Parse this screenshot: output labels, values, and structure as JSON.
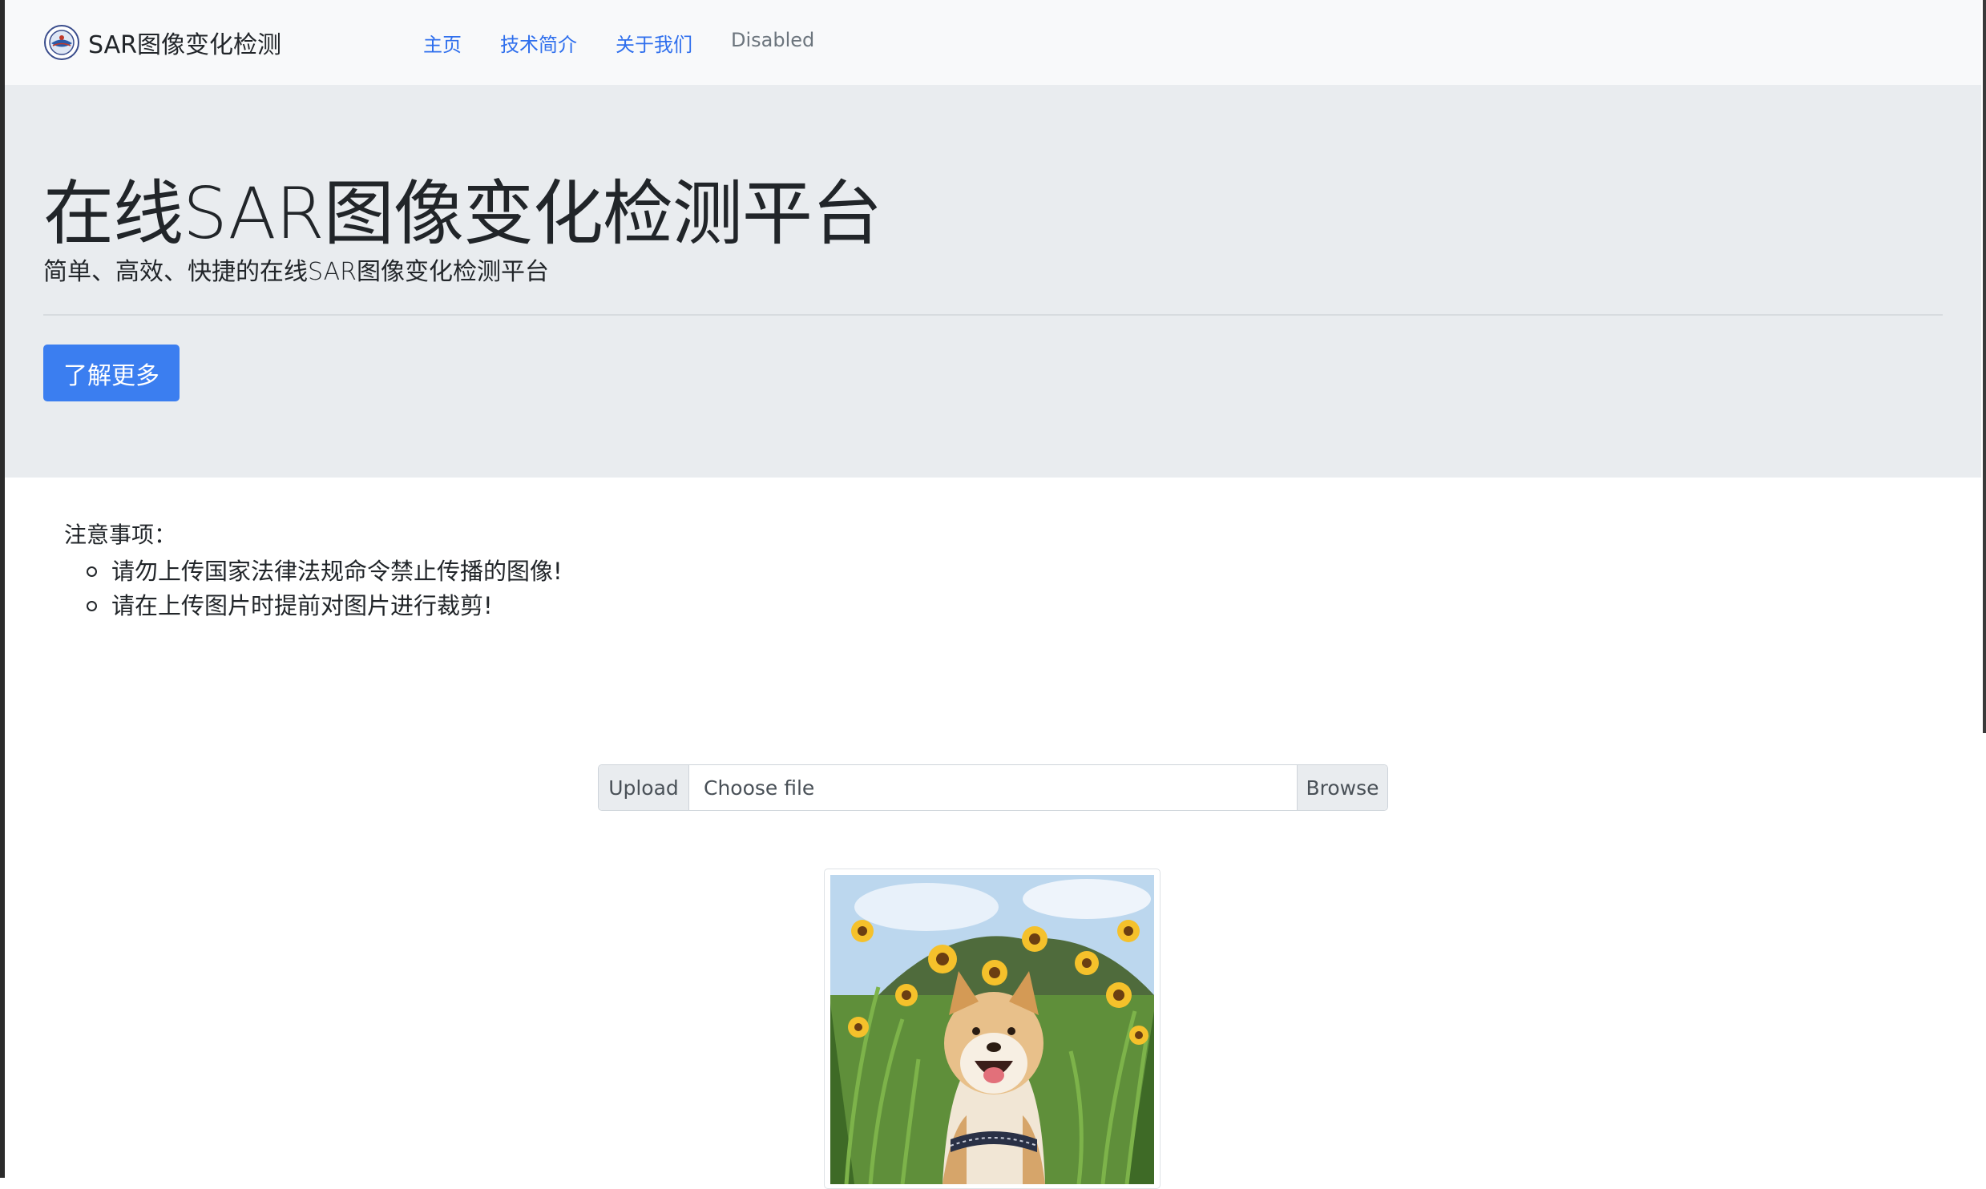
{
  "navbar": {
    "brand": "SAR图像变化检测",
    "links": [
      {
        "label": "主页",
        "disabled": false
      },
      {
        "label": "技术简介",
        "disabled": false
      },
      {
        "label": "关于我们",
        "disabled": false
      },
      {
        "label": "Disabled",
        "disabled": true
      }
    ]
  },
  "jumbotron": {
    "title": "在线SAR图像变化检测平台",
    "lead": "简单、高效、快捷的在线SAR图像变化检测平台",
    "button_label": "了解更多"
  },
  "notes": {
    "title": "注意事项：",
    "items": [
      "请勿上传国家法律法规命令禁止传播的图像!",
      "请在上传图片时提前对图片进行裁剪!"
    ]
  },
  "upload": {
    "label": "Upload",
    "placeholder": "Choose file",
    "browse_label": "Browse"
  },
  "colors": {
    "accent": "#3b7ef0",
    "link": "#2f6fed",
    "navbar_bg": "#f8f9fa",
    "jumbotron_bg": "#e9ecef"
  },
  "icons": {
    "brand_logo": "university-seal-logo",
    "preview": "shiba-dog-sunflower-image"
  }
}
